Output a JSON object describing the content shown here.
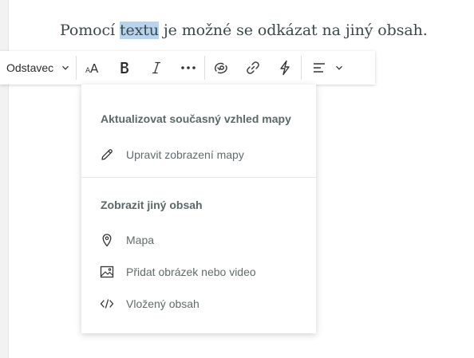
{
  "paragraph": {
    "before": "Pomocí ",
    "selected": "textu",
    "after": " je možné se odkázat na jiný obsah."
  },
  "toolbar": {
    "style_label": "Odstavec",
    "icons": {
      "style_dropdown": "chevron-down-icon",
      "font_size": "font-size-icon",
      "bold": "bold-icon",
      "italic": "italic-icon",
      "more": "more-icon",
      "map_action": "map-action-icon",
      "link": "link-icon",
      "action": "lightning-icon",
      "align": "align-left-icon",
      "align_dropdown": "chevron-down-icon"
    }
  },
  "dropdown": {
    "section1": {
      "heading": "Aktualizovat současný vzhled mapy",
      "items": [
        {
          "label": "Upravit zobrazení mapy",
          "icon": "pencil-icon"
        }
      ]
    },
    "section2": {
      "heading": "Zobrazit jiný obsah",
      "items": [
        {
          "label": "Mapa",
          "icon": "map-pin-icon"
        },
        {
          "label": "Přidat obrázek nebo video",
          "icon": "image-icon"
        },
        {
          "label": "Vložený obsah",
          "icon": "code-icon"
        }
      ]
    }
  },
  "colors": {
    "selection": "#b7d3ee",
    "text": "#3a4a4a",
    "heading": "#5a6868"
  }
}
